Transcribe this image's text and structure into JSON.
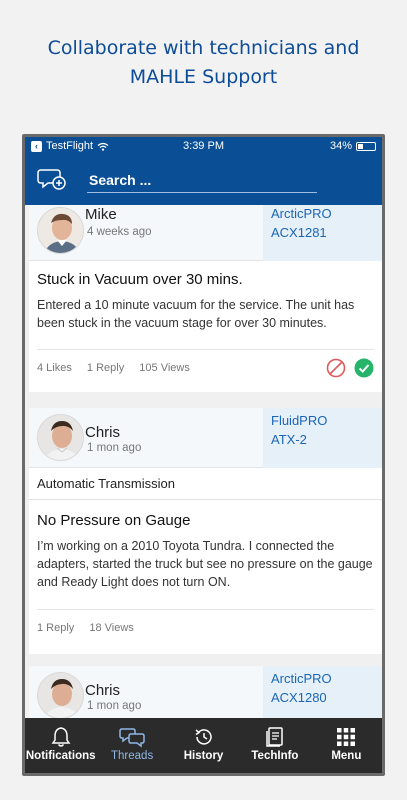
{
  "promo": {
    "line1": "Collaborate with technicians and",
    "line2": "MAHLE Support"
  },
  "status": {
    "back_label": "TestFlight",
    "time": "3:39 PM",
    "battery": "34%",
    "battery_level": 0.34
  },
  "search": {
    "placeholder": "Search ..."
  },
  "threads": [
    {
      "author": "Mike",
      "ago": "4 weeks ago",
      "device_line1": "ArcticPRO",
      "device_line2": "ACX1281",
      "title": "Stuck in Vacuum over 30 mins.",
      "body": "Entered a 10 minute vacuum for the service. The unit has been stuck in the vacuum stage for over 30 minutes.",
      "likes": "4 Likes",
      "replies": "1 Reply",
      "views": "105 Views"
    },
    {
      "author": "Chris",
      "ago": "1 mon ago",
      "device_line1": "FluidPRO",
      "device_line2": "ATX-2",
      "category": "Automatic Transmission",
      "title": "No Pressure on Gauge",
      "body": "I’m working on a 2010 Toyota Tundra. I connected the adapters, started the truck but see no pressure on the gauge and Ready Light does not turn ON.",
      "replies": "1 Reply",
      "views": "18 Views"
    },
    {
      "author": "Chris",
      "ago": "1 mon ago",
      "device_line1": "ArcticPRO",
      "device_line2": "ACX1280"
    }
  ],
  "tabs": [
    {
      "label": "Notifications",
      "icon": "bell-icon"
    },
    {
      "label": "Threads",
      "icon": "chat-bubbles-icon"
    },
    {
      "label": "History",
      "icon": "history-icon"
    },
    {
      "label": "TechInfo",
      "icon": "book-icon"
    },
    {
      "label": "Menu",
      "icon": "grid-icon"
    }
  ],
  "colors": {
    "brand_blue": "#0a4f96",
    "link_blue": "#1a66b5",
    "active_tab": "#8fb8e6",
    "tabbar": "#2b2b2b",
    "reject_red": "#e05a5a",
    "accept_green": "#26b36a"
  }
}
